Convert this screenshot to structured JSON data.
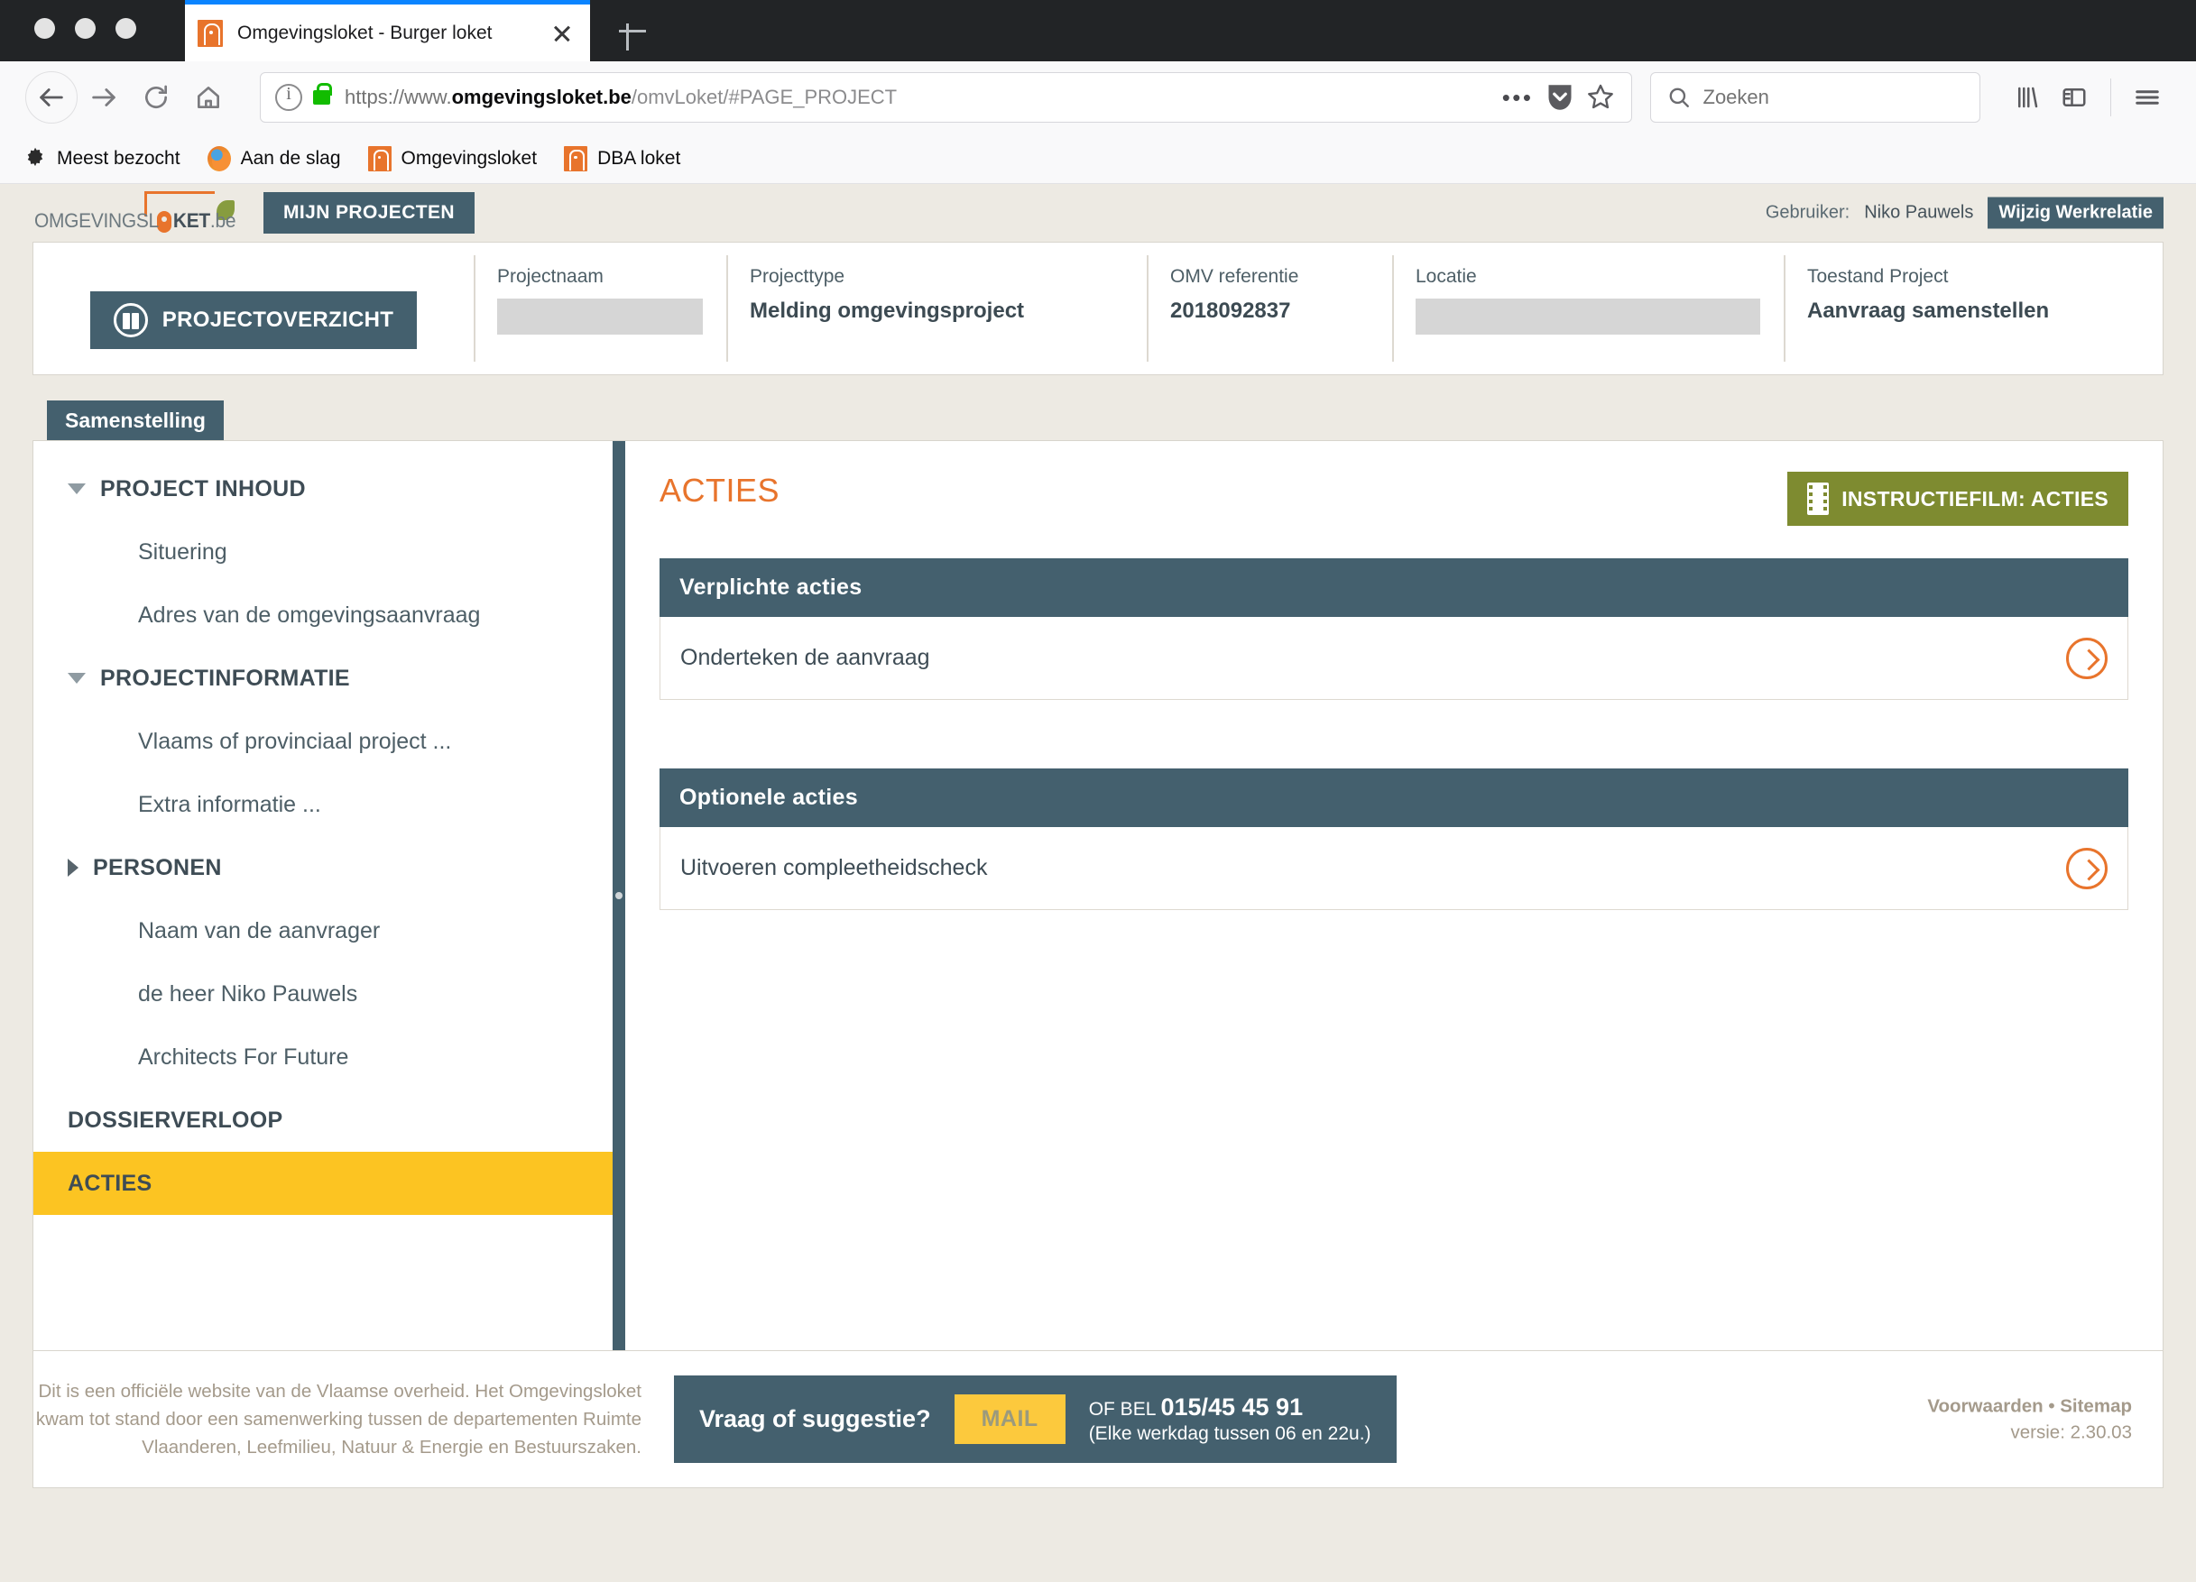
{
  "browser": {
    "tab": {
      "title": "Omgevingsloket - Burger loket",
      "favicon_icon": "house-icon"
    },
    "newtab_icon": "plus-icon",
    "nav": {
      "back_icon": "back-arrow-icon",
      "forward_icon": "forward-arrow-icon",
      "reload_icon": "reload-icon",
      "home_icon": "home-icon"
    },
    "url": {
      "info_icon": "info-icon",
      "lock_icon": "lock-icon",
      "scheme": "https://www.",
      "host": "omgevingsloket.be",
      "path": "/omvLoket/#PAGE_PROJECT",
      "menu_icon": "ellipsis-icon",
      "pocket_icon": "pocket-shield-icon",
      "bookmark_icon": "star-icon"
    },
    "search": {
      "placeholder": "Zoeken",
      "icon": "search-icon"
    },
    "right_icons": [
      "library-icon",
      "sidebar-icon",
      "hamburger-menu-icon"
    ],
    "bookmarks": [
      {
        "label": "Meest bezocht",
        "icon": "gear-icon"
      },
      {
        "label": "Aan de slag",
        "icon": "firefox-icon"
      },
      {
        "label": "Omgevingsloket",
        "icon": "house-icon"
      },
      {
        "label": "DBA loket",
        "icon": "house-icon"
      }
    ]
  },
  "app": {
    "logo": {
      "text_light": "OMGEVINGSL",
      "text_pin": "O",
      "text_dark": "KET",
      "text_suffix": ".be"
    },
    "mijn_projecten": "MIJN PROJECTEN",
    "user": {
      "label": "Gebruiker:",
      "name": "Niko Pauwels",
      "switch_button": "Wijzig Werkrelatie"
    }
  },
  "overview": {
    "button": "PROJECTOVERZICHT",
    "button_icon": "binder-icon",
    "fields": [
      {
        "label": "Projectnaam",
        "value": "",
        "masked": true
      },
      {
        "label": "Projecttype",
        "value": "Melding omgevingsproject",
        "masked": false
      },
      {
        "label": "OMV referentie",
        "value": "2018092837",
        "masked": false
      },
      {
        "label": "Locatie",
        "value": "",
        "masked": true
      },
      {
        "label": "Toestand Project",
        "value": "Aanvraag samenstellen",
        "masked": false
      }
    ]
  },
  "tabs": [
    {
      "label": "Samenstelling",
      "active": true
    }
  ],
  "sidebar": {
    "items": [
      {
        "label": "PROJECT INHOUD",
        "type": "group",
        "caret": "down",
        "selected": false
      },
      {
        "label": "Situering",
        "type": "leaf",
        "caret": "none",
        "selected": false
      },
      {
        "label": "Adres van de omgevingsaanvraag",
        "type": "leaf",
        "caret": "none",
        "selected": false
      },
      {
        "label": "PROJECTINFORMATIE",
        "type": "group",
        "caret": "down",
        "selected": false
      },
      {
        "label": "Vlaams of provinciaal project ...",
        "type": "leaf",
        "caret": "none",
        "selected": false
      },
      {
        "label": "Extra informatie ...",
        "type": "leaf",
        "caret": "none",
        "selected": false
      },
      {
        "label": "PERSONEN",
        "type": "group",
        "caret": "right",
        "selected": false
      },
      {
        "label": "Naam van de aanvrager",
        "type": "leaf",
        "caret": "none",
        "selected": false
      },
      {
        "label": "de heer Niko Pauwels",
        "type": "leaf",
        "caret": "none",
        "selected": false
      },
      {
        "label": "Architects For Future",
        "type": "leaf",
        "caret": "none",
        "selected": false
      },
      {
        "label": "DOSSIERVERLOOP",
        "type": "group",
        "caret": "none",
        "selected": false
      },
      {
        "label": "ACTIES",
        "type": "group",
        "caret": "none",
        "selected": true
      }
    ]
  },
  "content": {
    "title": "ACTIES",
    "instructiefilm_button": "INSTRUCTIEFILM: ACTIES",
    "instructiefilm_icon": "film-strip-icon",
    "sections": [
      {
        "heading": "Verplichte acties",
        "rows": [
          {
            "label": "Onderteken de aanvraag",
            "action_icon": "chevron-right-circle-icon"
          }
        ]
      },
      {
        "heading": "Optionele acties",
        "rows": [
          {
            "label": "Uitvoeren compleetheidscheck",
            "action_icon": "chevron-right-circle-icon"
          }
        ]
      }
    ]
  },
  "footer": {
    "disclaimer": "Dit is een officiële website van de Vlaamse overheid. Het Omgevingsloket kwam tot stand door een samenwerking tussen de departementen Ruimte Vlaanderen, Leefmilieu, Natuur & Energie en Bestuurszaken.",
    "contact": {
      "question": "Vraag of suggestie?",
      "mail_button": "MAIL",
      "phone_prefix": "OF BEL ",
      "phone_number": "015/45 45 91",
      "phone_hours": "(Elke werkdag tussen 06 en 22u.)"
    },
    "links": "Voorwaarden • Sitemap",
    "version": "versie: 2.30.03"
  },
  "colors": {
    "brand_dark": "#44606e",
    "accent_orange": "#e8742c",
    "highlight_yellow": "#fcc422",
    "olive": "#7e8b30",
    "page_bg": "#edeae3"
  }
}
